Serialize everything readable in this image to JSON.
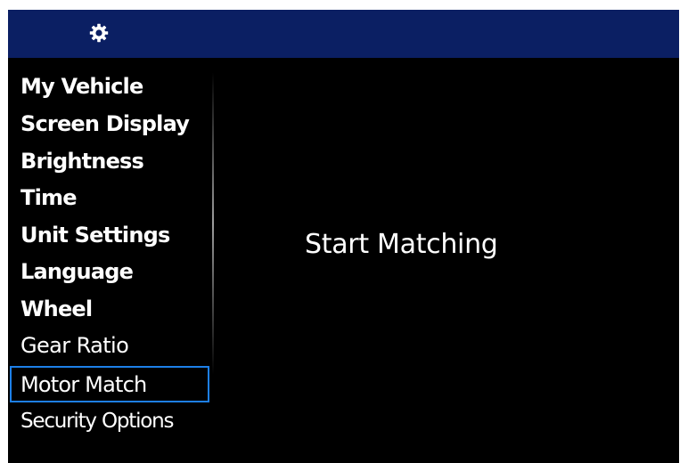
{
  "header": {
    "icon": "gear-icon",
    "background": "#0b1f63"
  },
  "menu": {
    "items": [
      {
        "label": "My Vehicle"
      },
      {
        "label": "Screen Display"
      },
      {
        "label": "Brightness"
      },
      {
        "label": "Time"
      },
      {
        "label": "Unit Settings"
      },
      {
        "label": "Language"
      },
      {
        "label": "Wheel"
      },
      {
        "label": "Gear Ratio"
      },
      {
        "label": "Motor Match",
        "selected": true
      },
      {
        "label": "Security Options"
      }
    ],
    "selection_color": "#1d7fe8"
  },
  "content": {
    "action_label": "Start Matching"
  },
  "colors": {
    "screen_background": "#000000",
    "text": "#ffffff"
  }
}
